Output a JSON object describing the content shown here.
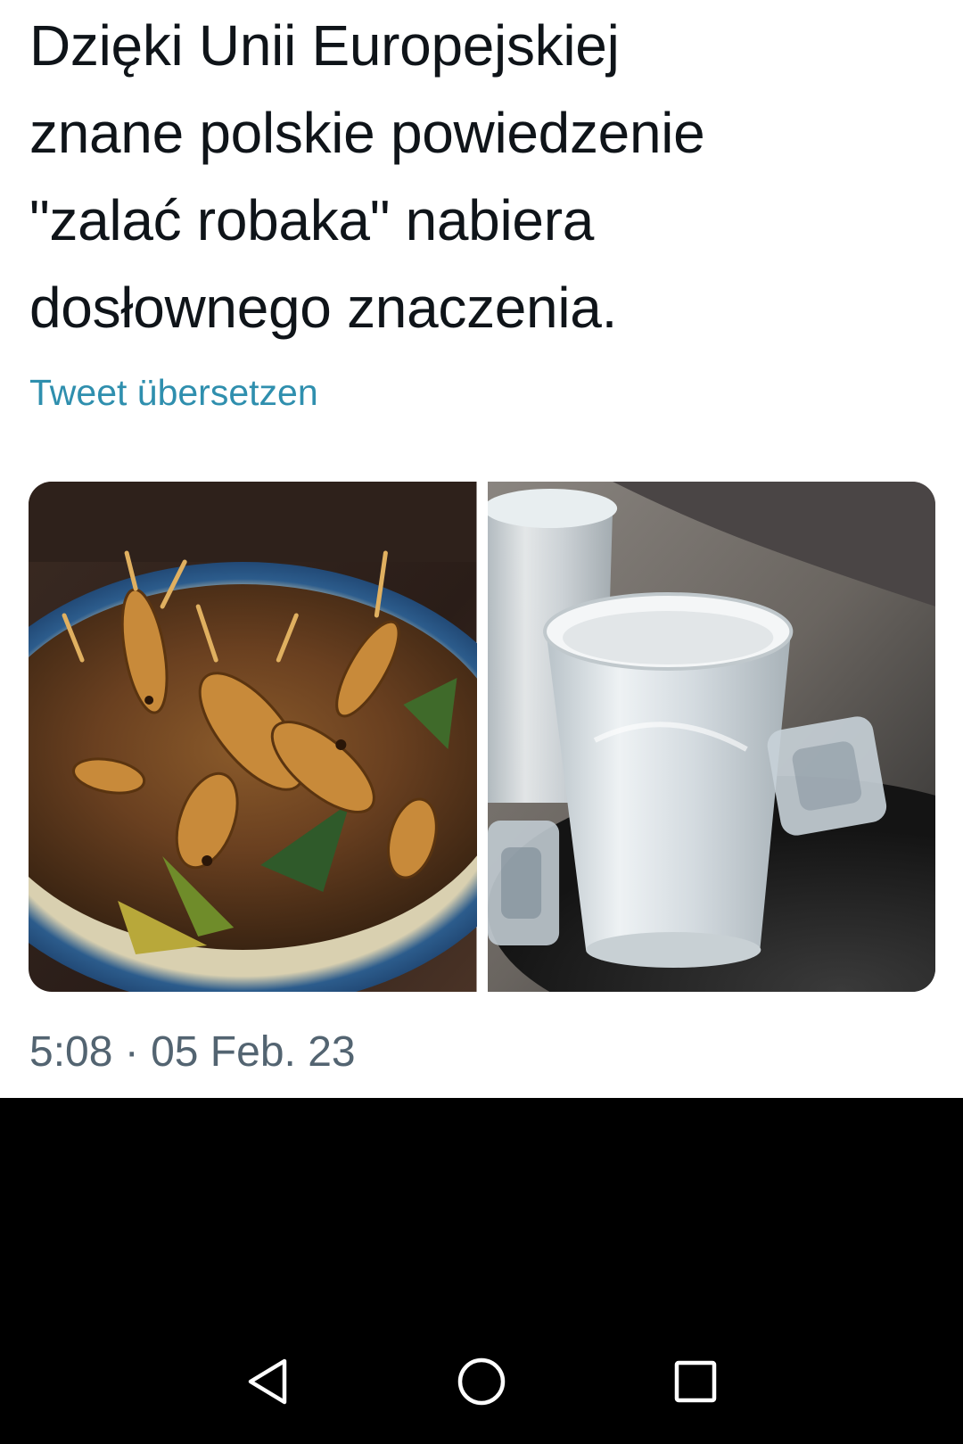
{
  "tweet": {
    "text_lines": [
      "Dzięki Unii Europejskiej",
      "znane polskie powiedzenie",
      "\"zalać robaka\" nabiera",
      "dosłownego znaczenia."
    ],
    "translate_label": "Tweet übersetzen",
    "timestamp": "5:08 · 05 Feb. 23",
    "media": [
      {
        "icon": "fried-grasshoppers-photo"
      },
      {
        "icon": "vodka-shot-glasses-photo"
      }
    ]
  },
  "system_nav": {
    "back_icon": "back-triangle-icon",
    "home_icon": "home-circle-icon",
    "recents_icon": "recents-square-icon"
  },
  "colors": {
    "text": "#0f1419",
    "link": "#2f8fae",
    "muted": "#536471",
    "nav_background": "#000000"
  }
}
